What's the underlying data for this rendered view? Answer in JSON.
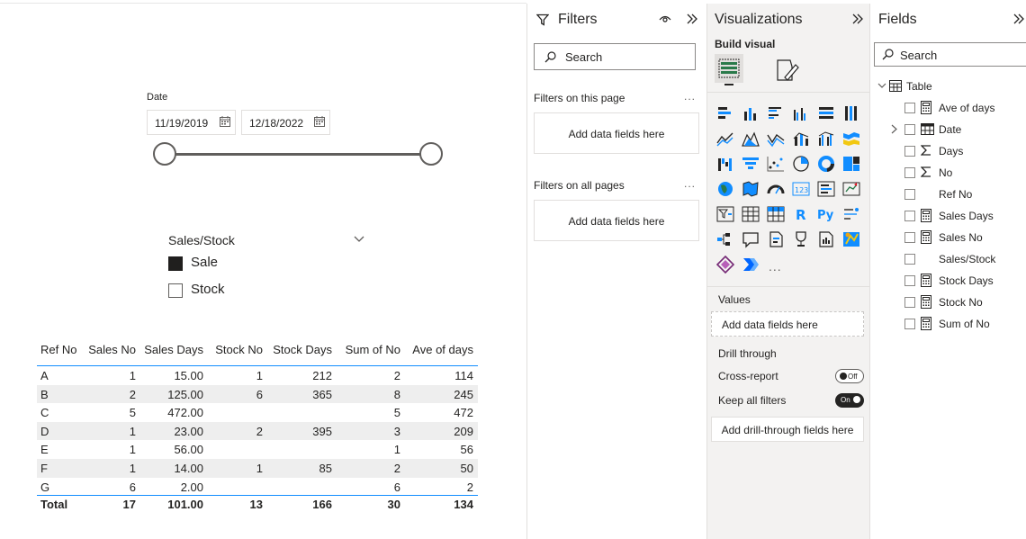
{
  "slicer_date": {
    "label": "Date",
    "start": "11/19/2019",
    "end": "12/18/2022"
  },
  "slicer_sales": {
    "title": "Sales/Stock",
    "options": [
      {
        "label": "Sale",
        "checked": true
      },
      {
        "label": "Stock",
        "checked": false
      }
    ]
  },
  "table": {
    "columns": [
      "Ref No",
      "Sales No",
      "Sales Days",
      "Stock No",
      "Stock Days",
      "Sum of No",
      "Ave of days"
    ],
    "rows": [
      [
        "A",
        "1",
        "15.00",
        "1",
        "212",
        "2",
        "114"
      ],
      [
        "B",
        "2",
        "125.00",
        "6",
        "365",
        "8",
        "245"
      ],
      [
        "C",
        "5",
        "472.00",
        "",
        "",
        "5",
        "472"
      ],
      [
        "D",
        "1",
        "23.00",
        "2",
        "395",
        "3",
        "209"
      ],
      [
        "E",
        "1",
        "56.00",
        "",
        "",
        "1",
        "56"
      ],
      [
        "F",
        "1",
        "14.00",
        "1",
        "85",
        "2",
        "50"
      ],
      [
        "G",
        "6",
        "2.00",
        "",
        "",
        "6",
        "2"
      ]
    ],
    "total": [
      "Total",
      "17",
      "101.00",
      "13",
      "166",
      "30",
      "134"
    ]
  },
  "filters": {
    "title": "Filters",
    "search_placeholder": "Search",
    "on_page_label": "Filters on this page",
    "on_page_well": "Add data fields here",
    "all_pages_label": "Filters on all pages",
    "all_pages_well": "Add data fields here",
    "more": "..."
  },
  "visualizations": {
    "title": "Visualizations",
    "build_visual": "Build visual",
    "more": "...",
    "values_label": "Values",
    "values_well": "Add data fields here",
    "drill_through": "Drill through",
    "cross_report": "Cross-report",
    "cross_report_state": "Off",
    "keep_filters": "Keep all filters",
    "keep_filters_state": "On",
    "drill_well": "Add drill-through fields here",
    "icons": [
      "stacked-bar-chart-icon",
      "stacked-column-chart-icon",
      "clustered-bar-chart-icon",
      "clustered-column-chart-icon",
      "100-stacked-bar-chart-icon",
      "100-stacked-column-chart-icon",
      "line-chart-icon",
      "area-chart-icon",
      "stacked-area-chart-icon",
      "line-and-column-chart-icon",
      "line-and-clustered-column-chart-icon",
      "ribbon-chart-icon",
      "waterfall-chart-icon",
      "funnel-chart-icon",
      "scatter-chart-icon",
      "pie-chart-icon",
      "donut-chart-icon",
      "treemap-icon",
      "map-icon",
      "filled-map-icon",
      "gauge-icon",
      "card-icon",
      "multi-row-card-icon",
      "kpi-icon",
      "slicer-icon",
      "table-icon",
      "matrix-icon",
      "r-visual-icon",
      "python-visual-icon",
      "key-influencers-icon",
      "decomposition-tree-icon",
      "qa-icon",
      "smart-narrative-icon",
      "goals-icon",
      "paginated-report-icon",
      "azure-map-icon",
      "power-apps-icon",
      "power-automate-icon"
    ]
  },
  "fields": {
    "title": "Fields",
    "search_placeholder": "Search",
    "table_name": "Table",
    "items": [
      {
        "label": "Ave of days",
        "icon": "calculator-icon",
        "expand": false
      },
      {
        "label": "Date",
        "icon": "calendar-table-icon",
        "expand": true
      },
      {
        "label": "Days",
        "icon": "sigma-icon",
        "expand": false
      },
      {
        "label": "No",
        "icon": "sigma-icon",
        "expand": false
      },
      {
        "label": "Ref No",
        "icon": "",
        "expand": false
      },
      {
        "label": "Sales Days",
        "icon": "calculator-icon",
        "expand": false
      },
      {
        "label": "Sales No",
        "icon": "calculator-icon",
        "expand": false
      },
      {
        "label": "Sales/Stock",
        "icon": "",
        "expand": false
      },
      {
        "label": "Stock Days",
        "icon": "calculator-icon",
        "expand": false
      },
      {
        "label": "Stock No",
        "icon": "calculator-icon",
        "expand": false
      },
      {
        "label": "Sum of No",
        "icon": "calculator-icon",
        "expand": false
      }
    ]
  },
  "colors": {
    "accent": "#118dff",
    "pane_bg": "#f3f2f1",
    "row_shade": "#eeeeee",
    "dark": "#252423"
  }
}
